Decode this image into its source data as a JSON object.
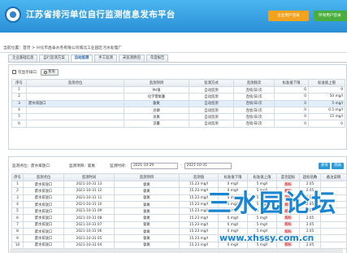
{
  "header": {
    "title": "江苏省排污单位自行监测信息发布平台",
    "btn_enterprise": "企业用户登录",
    "btn_environment": "环保用户登录"
  },
  "breadcrumb": {
    "label": "当前位置：首页 > 兴化市昌泰水务有限公司城北工业园区污水处理厂"
  },
  "tabs": [
    {
      "label": "企业基础信息"
    },
    {
      "label": "自行监测方案"
    },
    {
      "label": "自动监测"
    },
    {
      "label": "手工监测"
    },
    {
      "label": "未监测原因"
    },
    {
      "label": "年度报告"
    }
  ],
  "top_panel": {
    "filter_label": "仅显示排口",
    "query_label": "查询",
    "headers": [
      "序号",
      "监测点位",
      "监测项目",
      "监测方式",
      "监测频次",
      "标准值下限",
      "标准值上限"
    ],
    "rows": [
      {
        "no": "1",
        "point": "",
        "item": "PH值",
        "mode": "自动监测",
        "freq": "连续/日/次",
        "low": "6",
        "high": "9"
      },
      {
        "no": "2",
        "point": "",
        "item": "化学需氧量",
        "mode": "自动监测",
        "freq": "连续/日/次",
        "low": "0",
        "high": "50 mg/l"
      },
      {
        "no": "3",
        "point": "废水排放口",
        "item": "氨氮",
        "mode": "自动监测",
        "freq": "连续/日/次",
        "low": "0",
        "high": "5 mg/l"
      },
      {
        "no": "4",
        "point": "",
        "item": "总磷",
        "mode": "自动监测",
        "freq": "连续/日/次",
        "low": "0",
        "high": "0.5 mg/l"
      },
      {
        "no": "5",
        "point": "",
        "item": "总氮",
        "mode": "自动监测",
        "freq": "连续/日/次",
        "low": "0",
        "high": "15 mg/l"
      },
      {
        "no": "6",
        "point": "",
        "item": "流量",
        "mode": "自动监测",
        "freq": "连续/日/次",
        "low": "0",
        "high": "0"
      }
    ]
  },
  "bottom_panel": {
    "point_label": "监测点位：废水排放口",
    "item_label": "监测项目：氨氮",
    "time_label": "监测时间：",
    "date_from": "2021-10-29",
    "date_to": "2021-10-31",
    "btn_query": "查询",
    "btn_chart": "图表",
    "headers": [
      "序号",
      "监测点位",
      "监测时间",
      "监测项目",
      "监测值",
      "标准值下限",
      "标准值上限",
      "是否超标",
      "超标倍数",
      "备注说明"
    ],
    "rows": [
      {
        "no": "1",
        "point": "废水排放口",
        "time": "2021-10-31 13",
        "item": "氨氮",
        "value": "15.23 mg/l",
        "low": "0 mg/l",
        "high": "5 mg/l",
        "over": "超标",
        "times": "2.05",
        "note": ""
      },
      {
        "no": "2",
        "point": "废水排放口",
        "time": "2021-10-31 12",
        "item": "氨氮",
        "value": "15.23 mg/l",
        "low": "0 mg/l",
        "high": "5 mg/l",
        "over": "超标",
        "times": "2.05",
        "note": ""
      },
      {
        "no": "3",
        "point": "废水排放口",
        "time": "2021-10-31 11",
        "item": "氨氮",
        "value": "15.23 mg/l",
        "low": "0 mg/l",
        "high": "5 mg/l",
        "over": "超标",
        "times": "2.05",
        "note": ""
      },
      {
        "no": "4",
        "point": "废水排放口",
        "time": "2021-10-31 10",
        "item": "氨氮",
        "value": "15.23 mg/l",
        "low": "0 mg/l",
        "high": "5 mg/l",
        "over": "超标",
        "times": "2.05",
        "note": ""
      },
      {
        "no": "5",
        "point": "废水排放口",
        "time": "2021-10-31 09",
        "item": "氨氮",
        "value": "15.23 mg/l",
        "low": "0 mg/l",
        "high": "5 mg/l",
        "over": "超标",
        "times": "2.05",
        "note": ""
      },
      {
        "no": "6",
        "point": "废水排放口",
        "time": "2021-10-31 08",
        "item": "氨氮",
        "value": "15.23 mg/l",
        "low": "0 mg/l",
        "high": "5 mg/l",
        "over": "超标",
        "times": "2.05",
        "note": ""
      },
      {
        "no": "7",
        "point": "废水排放口",
        "time": "2021-10-31 07",
        "item": "氨氮",
        "value": "15.23 mg/l",
        "low": "0 mg/l",
        "high": "5 mg/l",
        "over": "超标",
        "times": "2.05",
        "note": ""
      },
      {
        "no": "8",
        "point": "废水排放口",
        "time": "2021-10-31 06",
        "item": "氨氮",
        "value": "15.23 mg/l",
        "low": "0 mg/l",
        "high": "5 mg/l",
        "over": "超标",
        "times": "2.05",
        "note": ""
      },
      {
        "no": "9",
        "point": "废水排放口",
        "time": "2021-10-31 05",
        "item": "氨氮",
        "value": "15.23 mg/l",
        "low": "0 mg/l",
        "high": "5 mg/l",
        "over": "超标",
        "times": "2.05",
        "note": ""
      },
      {
        "no": "10",
        "point": "废水排放口",
        "time": "2021-10-31 04",
        "item": "氨氮",
        "value": "15.23 mg/l",
        "low": "0 mg/l",
        "high": "5 mg/l",
        "over": "超标",
        "times": "2.05",
        "note": ""
      }
    ]
  },
  "watermark": {
    "text": "三水园论坛",
    "url": "www.xhssy.com.cn"
  },
  "colors": {
    "header_blue": "#2b8fd6",
    "btn_orange": "#f3a21c",
    "btn_green": "#4aae3d",
    "over_red": "#e03030",
    "watermark_blue": "#1a86d2"
  }
}
